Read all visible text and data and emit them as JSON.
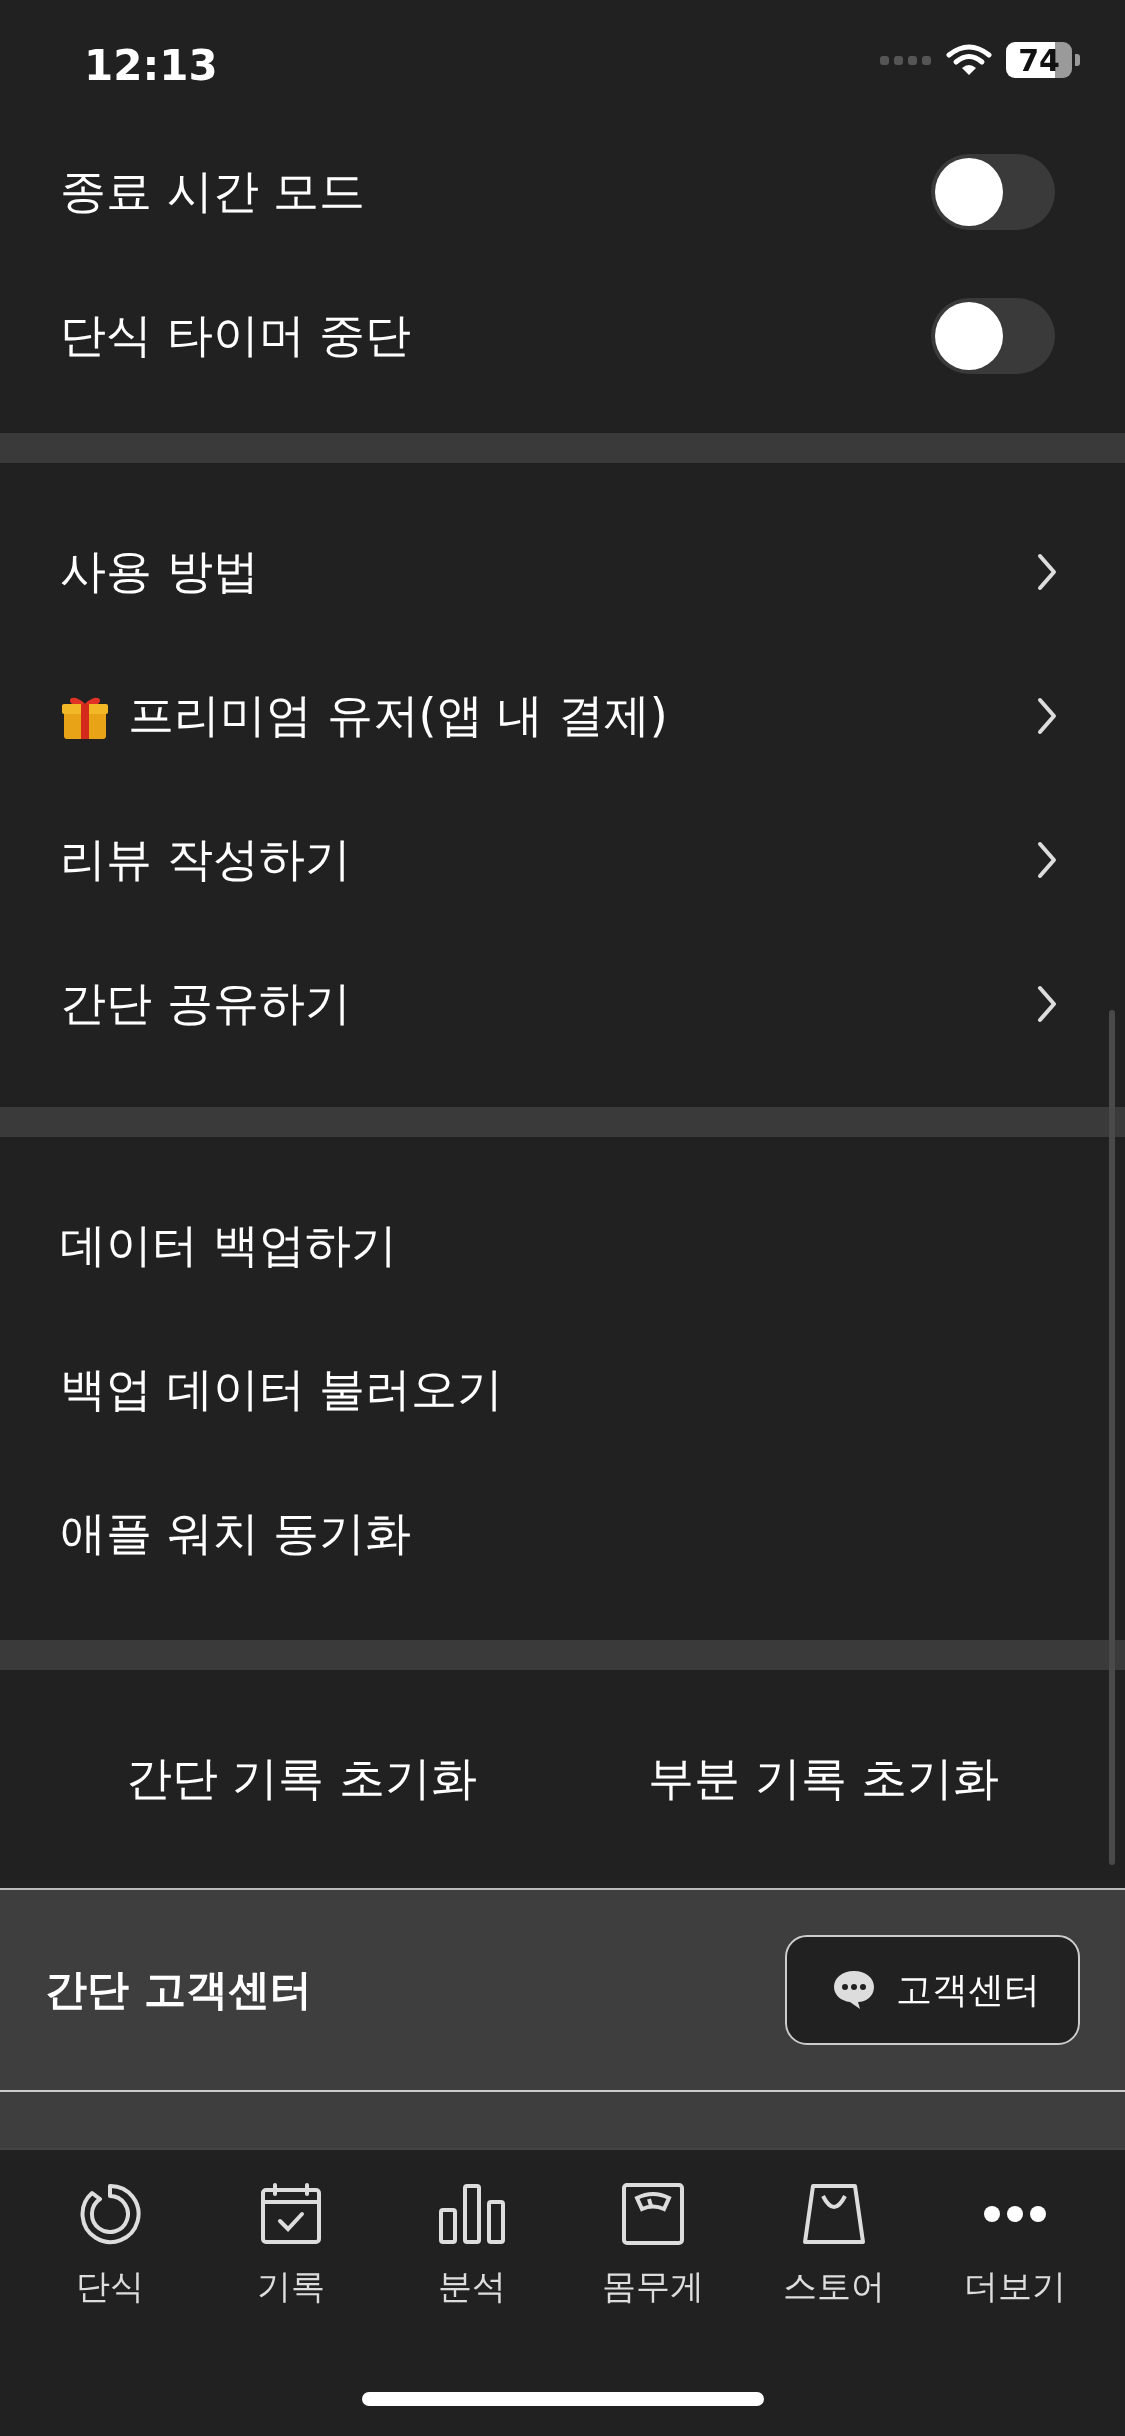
{
  "status_bar": {
    "time": "12:13",
    "battery": "74"
  },
  "toggles": [
    {
      "label": "종료 시간 모드",
      "on": false
    },
    {
      "label": "단식 타이머 중단",
      "on": false
    }
  ],
  "menu": [
    {
      "label": "사용 방법",
      "kind": "plain"
    },
    {
      "label": "프리미엄 유저(앱 내 결제)",
      "kind": "gift"
    },
    {
      "label": "리뷰 작성하기",
      "kind": "plain"
    },
    {
      "label": "간단 공유하기",
      "kind": "plain"
    }
  ],
  "data_menu": [
    "데이터 백업하기",
    "백업 데이터 불러오기",
    "애플 워치 동기화"
  ],
  "reset_buttons": [
    "간단 기록 초기화",
    "부분 기록 초기화"
  ],
  "customer_center": {
    "title": "간단 고객센터",
    "button": "고객센터"
  },
  "tabs": [
    {
      "label": "단식",
      "kind": "timer"
    },
    {
      "label": "기록",
      "kind": "calendar"
    },
    {
      "label": "분석",
      "kind": "bars"
    },
    {
      "label": "몸무게",
      "kind": "scale"
    },
    {
      "label": "스토어",
      "kind": "bag"
    },
    {
      "label": "더보기",
      "kind": "more"
    }
  ]
}
